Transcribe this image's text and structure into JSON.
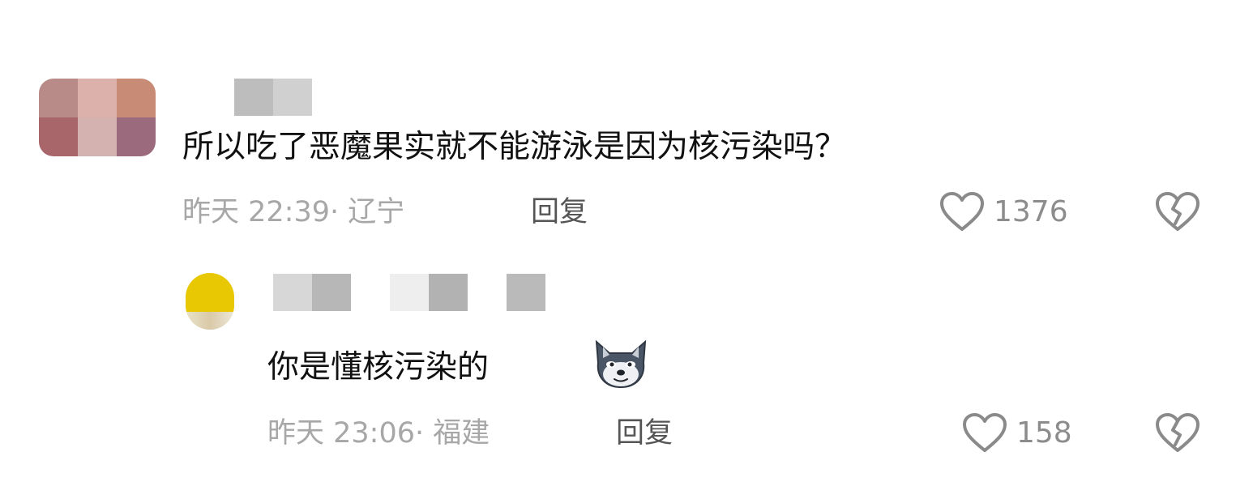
{
  "comments": [
    {
      "text": "所以吃了恶魔果实就不能游泳是因为核污染吗？",
      "time": "昨天 22:39",
      "location": "· 辽宁",
      "reply_label": "回复",
      "likes": "1376",
      "avatar_colors": [
        "#b88a88",
        "#dcb0ab",
        "#c78b76",
        "#a8666b",
        "#d3b2b0",
        "#9b6a7c"
      ],
      "name_colors": [
        "#bdbdbd",
        "#d0d0d0"
      ]
    },
    {
      "text": "你是懂核污染的",
      "emoji": "husky-emoji-icon",
      "time": "昨天 23:06",
      "location": "· 福建",
      "reply_label": "回复",
      "likes": "158",
      "name_colors": [
        "#d7d7d7",
        "#b7b7b7",
        "#eeeeee",
        "#b2b2b2",
        "#bababa"
      ]
    }
  ],
  "icons": {
    "like": "heart-outline-icon",
    "dislike": "broken-heart-icon"
  }
}
